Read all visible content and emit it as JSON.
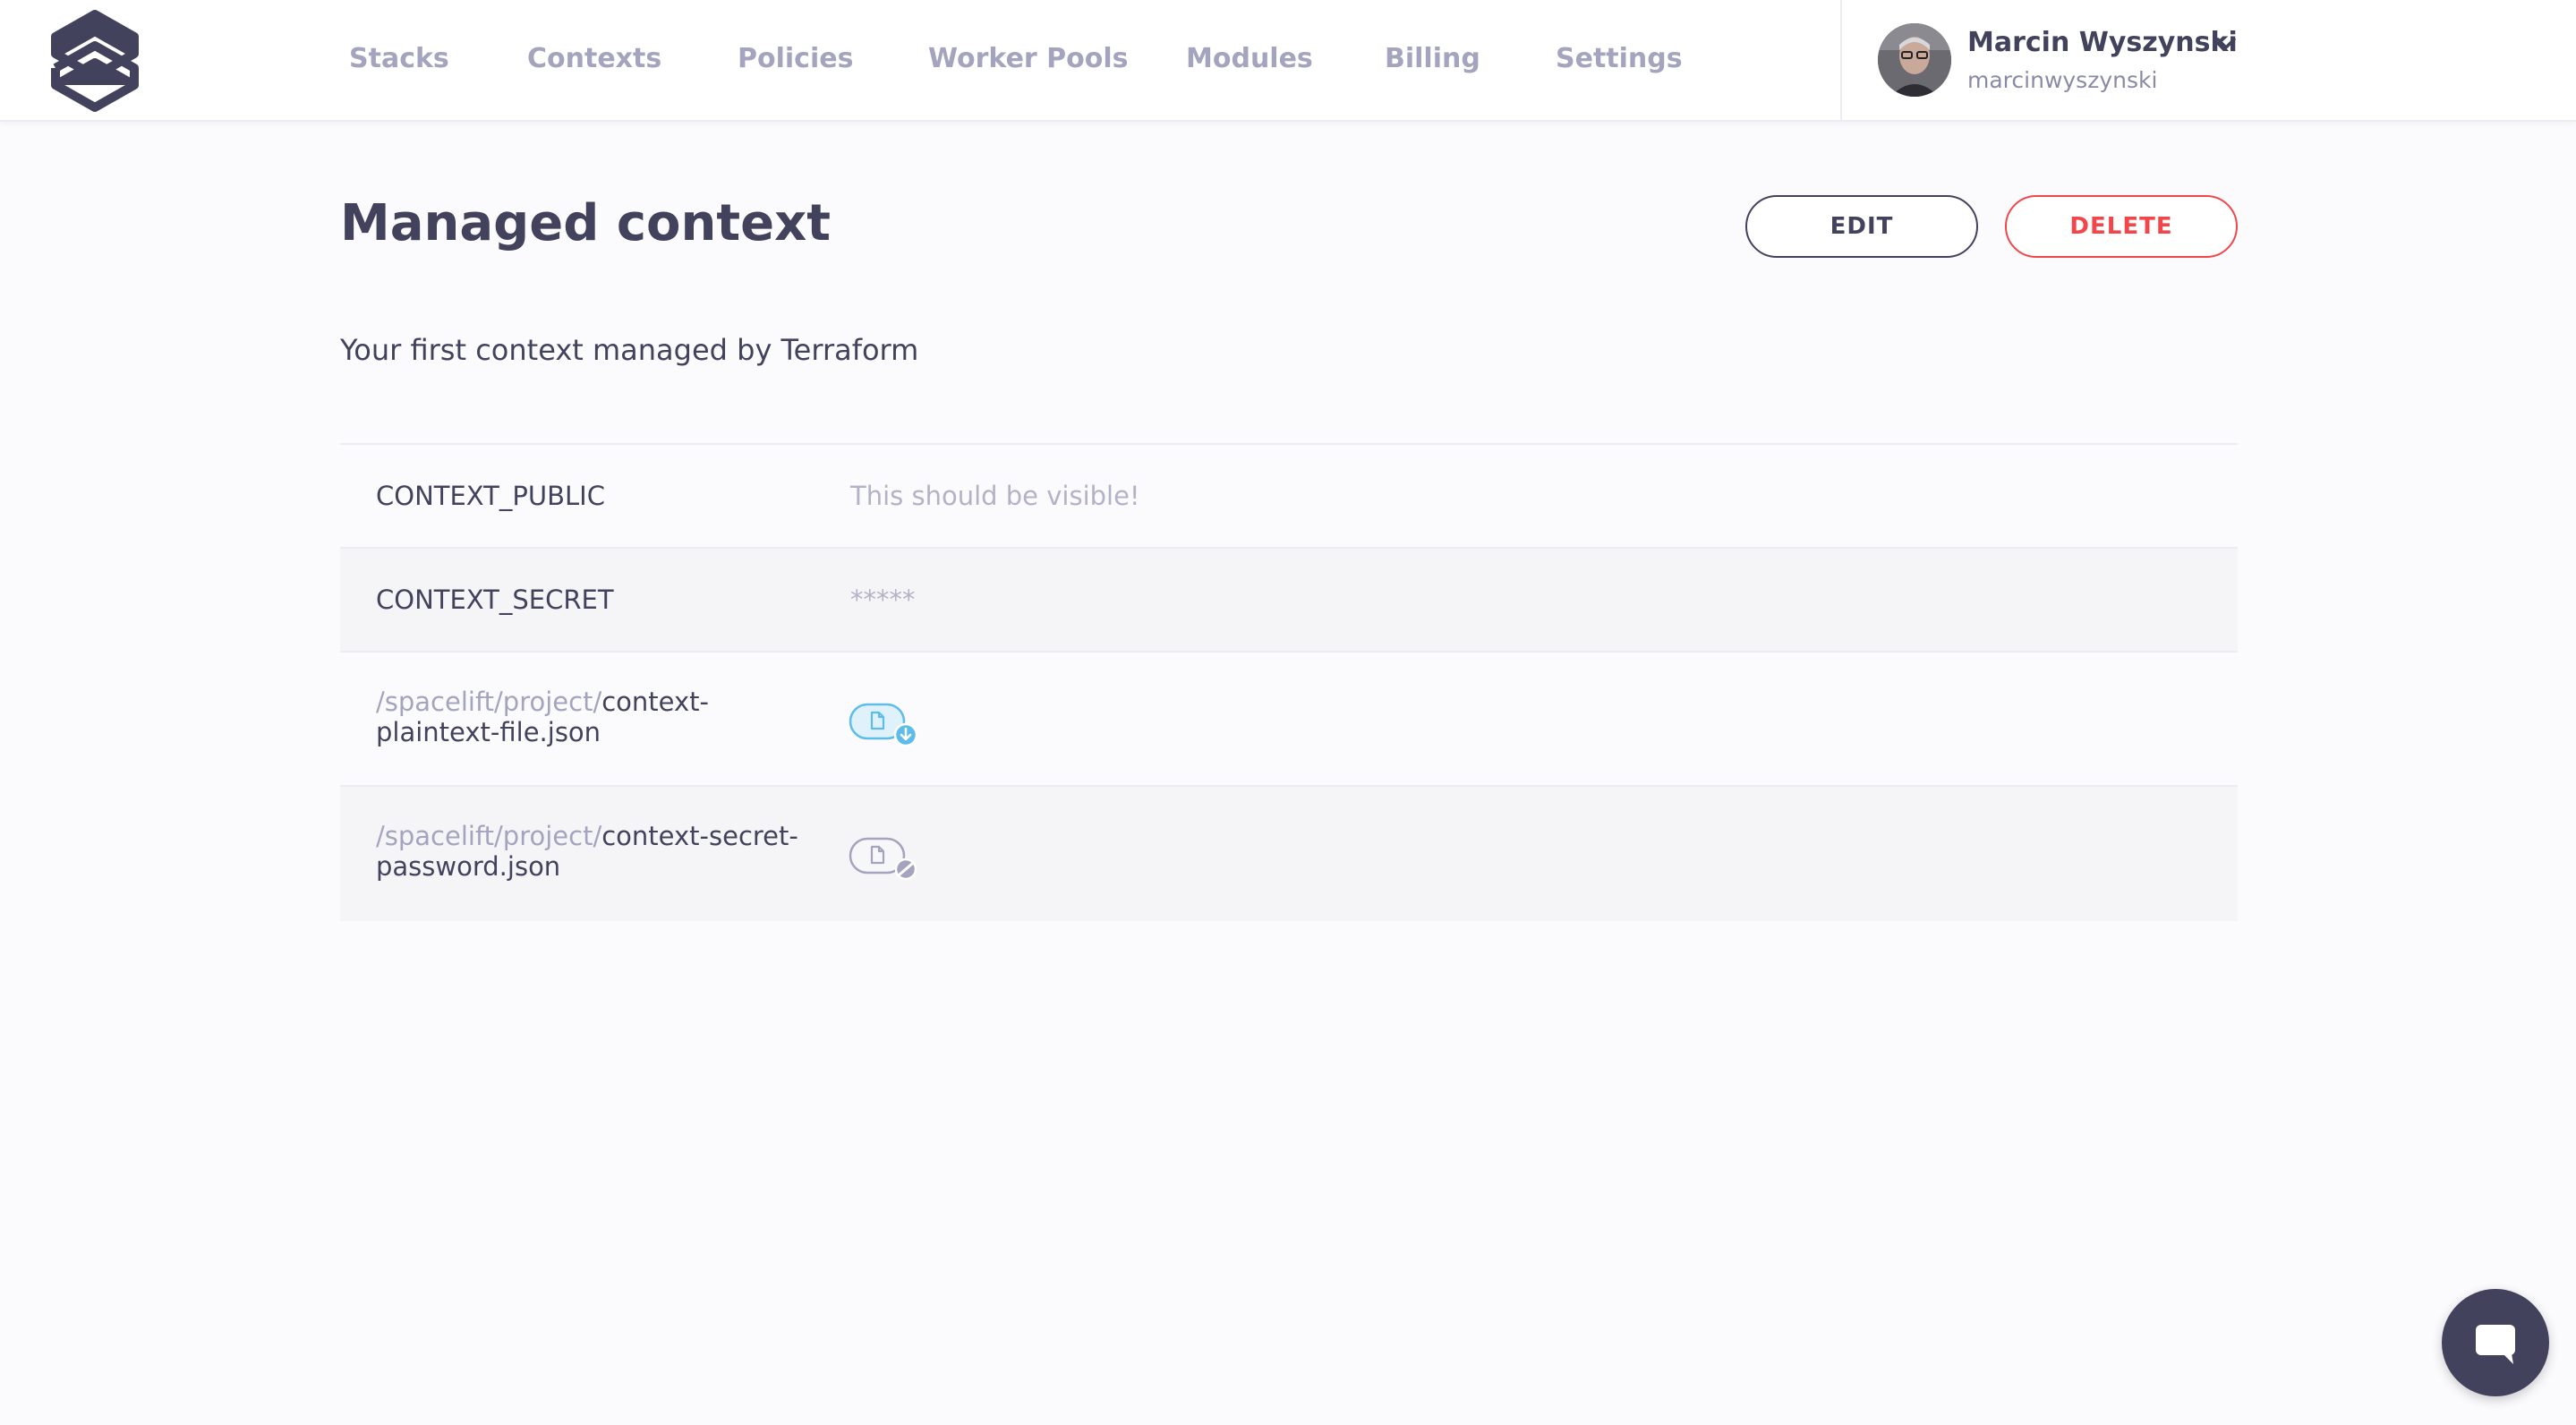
{
  "nav": {
    "items": [
      {
        "label": "Stacks"
      },
      {
        "label": "Contexts"
      },
      {
        "label": "Policies"
      },
      {
        "label": "Worker Pools"
      },
      {
        "label": "Modules"
      },
      {
        "label": "Billing"
      },
      {
        "label": "Settings"
      }
    ]
  },
  "user": {
    "name": "Marcin Wyszynski",
    "handle": "marcinwyszynski"
  },
  "context": {
    "title": "Managed context",
    "description": "Your first context managed by Terraform",
    "edit_label": "EDIT",
    "delete_label": "DELETE"
  },
  "rows": [
    {
      "type": "variable",
      "name": "CONTEXT_PUBLIC",
      "value": "This should be visible!"
    },
    {
      "type": "variable",
      "name": "CONTEXT_SECRET",
      "value": "*****"
    },
    {
      "type": "file",
      "path_prefix": "/spacelift/project/",
      "file_name": "context-plaintext-file.json",
      "icon": "file-download-icon"
    },
    {
      "type": "file",
      "path_prefix": "/spacelift/project/",
      "file_name": "context-secret-password.json",
      "icon": "file-locked-icon"
    }
  ],
  "colors": {
    "accent": "#43425d",
    "danger": "#f2464a",
    "muted": "#a5a4bf",
    "download_badge": "#5ebde8"
  },
  "chat": {
    "icon": "chat-icon"
  }
}
